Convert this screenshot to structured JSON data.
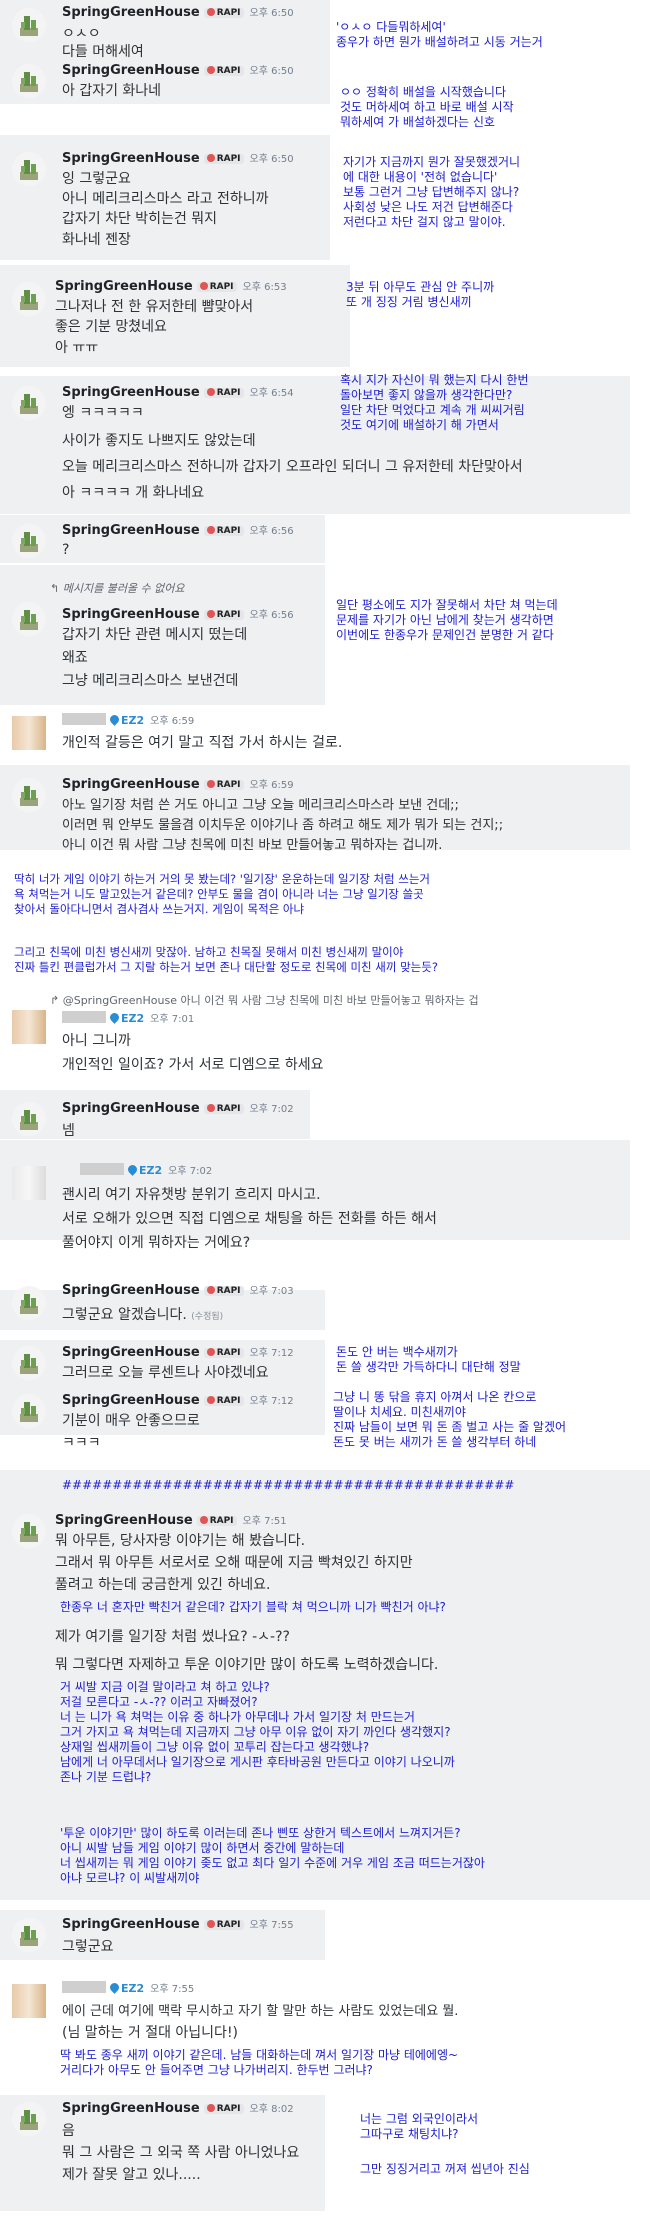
{
  "colors": {
    "annotation": "#2020d0",
    "highlight": "#eef0f2",
    "link": "#2a8cd4"
  },
  "user": {
    "name": "SpringGreenHouse",
    "badge": "RAPI"
  },
  "other": {
    "badge": "EZ2"
  },
  "msgs": [
    {
      "time": "오후 6:50",
      "lines": [
        "ㅇㅅㅇ",
        "다들 머해세여"
      ]
    },
    {
      "time": "오후 6:50",
      "lines": [
        "아 갑자기 화나네"
      ]
    },
    {
      "time": "오후 6:50",
      "lines": [
        "잉 그렇군요",
        "아니 메리크리스마스 라고 전하니까",
        "갑자기 차단 박히는건 뭐지",
        "화나네 젠장"
      ]
    },
    {
      "time": "오후 6:53",
      "lines": [
        "그나저나 전 한 유저한테 뺨맞아서",
        "좋은 기분 망쳤네요",
        "아 ㅠㅠ"
      ]
    },
    {
      "time": "오후 6:54",
      "lines": [
        "엥 ㅋㅋㅋㅋㅋ",
        "사이가 좋지도 나쁘지도 않았는데",
        "오늘 메리크리스마스 전하니까 갑자기 오프라인 되더니 그 유저한테 차단맞아서",
        "아 ㅋㅋㅋㅋ 개 화나네요"
      ]
    },
    {
      "time": "오후 6:56",
      "lines": [
        "?"
      ]
    },
    {
      "reply": "메시지를 불러올 수 없어요",
      "time": "오후 6:56",
      "lines": [
        "갑자기 차단 관련 메시지 떴는데",
        "왜죠",
        "그냥 메리크리스마스 보낸건데"
      ]
    },
    {
      "time": "오후 6:59",
      "lines": [
        "개인적 갈등은 여기 말고 직접 가서 하시는 걸로."
      ]
    },
    {
      "time": "오후 6:59",
      "lines": [
        "아노 일기장 처럼 쓴 거도 아니고 그냥 오늘 메리크리스마스라 보낸 건데;;",
        "이러면 뭐 안부도 물을겸 이치두운 이야기나 좀 하려고 해도 제가 뭐가 되는 건지;;",
        "아니 이건 뭐 사람 그냥 친목에 미친 바보 만들어놓고 뭐하자는 겁니까."
      ]
    },
    {
      "reply": "@SpringGreenHouse 아니 이건 뭐 사람 그냥 친목에 미친 바보 만들어놓고 뭐하자는 겁",
      "time": "오후 7:01",
      "lines": [
        "아니 그니까",
        "개인적인 일이죠? 가서 서로 디엠으로 하세요"
      ]
    },
    {
      "time": "오후 7:02",
      "lines": [
        "넴"
      ]
    },
    {
      "time": "오후 7:02",
      "lines": [
        "괜시리 여기 자유챗방 분위기 흐리지 마시고.",
        "서로 오해가 있으면 직접 디엠으로 채팅을 하든 전화를 하든 해서",
        "풀어야지 이게 뭐하자는 거에요?"
      ]
    },
    {
      "time": "오후 7:03",
      "lines": [
        "그렇군요 알겠습니다."
      ],
      "edited": "(수정됨)"
    },
    {
      "time": "오후 7:12",
      "lines": [
        "그러므로 오늘 루센트나 사야겠네요"
      ]
    },
    {
      "time": "오후 7:12",
      "lines": [
        "기분이 매우 안좋으므로",
        "ㅋㅋㅋ"
      ]
    },
    {
      "time": "오후 7:51",
      "lines": [
        "뭐 아무튼, 당사자랑 이야기는 해 봤습니다.",
        "그래서 뭐 아무튼 서로서로 오해 때문에 지금 빡쳐있긴 하지만",
        "풀려고 하는데 궁금한게 있긴 하네요.",
        "제가 여기를 일기장 처럼 썼나요? -ㅅ-??",
        "뭐 그렇다면 자제하고 투운 이야기만 많이 하도록 노력하겠습니다."
      ]
    },
    {
      "time": "오후 7:55",
      "lines": [
        "그렇군요"
      ]
    },
    {
      "time": "오후 7:55",
      "lines": [
        "에이 근데 여기에 맥락 무시하고 자기 할 말만 하는 사람도 있었는데요 뭘.",
        "(님 말하는 거 절대 아닙니다!)"
      ]
    },
    {
      "time": "오후 8:02",
      "lines": [
        "음",
        "뭐 그 사람은 그 외국 쪽 사람 아니었나요",
        "제가 잘못 알고 있나....."
      ]
    }
  ],
  "notes": [
    {
      "text": [
        "'ㅇㅅㅇ 다들뭐하세여'",
        "종우가 하면 뭔가 배설하려고 시동 거는거"
      ]
    },
    {
      "text": [
        "ㅇㅇ 정확히 배설을 시작했습니다",
        "것도 머하세여 하고 바로 배설 시작",
        "뭐하세여 가 배설하겠다는 신호"
      ]
    },
    {
      "text": [
        "자기가 지금까지 뭔가 잘못했겠거니",
        "에 대한 내용이 '전혀 없습니다'",
        "보통 그런거 그냥 답변해주지 않나?",
        "사회성 낮은 나도 저건 답변해준다",
        "저런다고 차단 걸지 않고 말이야."
      ]
    },
    {
      "text": [
        "3분 뒤 아무도 관심 안 주니까",
        "또 개 징징 거림 병신새끼"
      ]
    },
    {
      "text": [
        "혹시 지가 자신이 뭐 했는지 다시 한번",
        "돌아보면 좋지 않을까 생각한다만?",
        "일단 차단 먹었다고 계속 개 씨씨거림",
        "것도 여기에 배설하기 해 가면서"
      ]
    },
    {
      "text": [
        "일단 평소에도 지가 잘못해서 차단 쳐 먹는데",
        "문제를 자기가 아닌 남에게 찾는거 생각하면",
        "이번에도 한종우가 문제인건 분명한 거 같다"
      ]
    },
    {
      "text": [
        "딱히 너가 게임 이야기 하는거 거의 못 봤는데? '일기장' 운운하는데 일기장 처럼 쓰는거",
        "욕 쳐먹는거 니도 말고있는거 같은데? 안부도 물을 겸이 아니라 너는 그냥 일기장 쓸곳",
        "찾아서 돌아다니면서 겸사겸사 쓰는거지. 게임이 목적은 아냐"
      ]
    },
    {
      "text": [
        "그리고 친목에 미친 병신새끼 맞잖아. 남하고 친목질 못해서 미친 병신새끼 말이야",
        "진짜 틀킨 편클럽가서 그 지랄 하는거 보면 존나 대단할 정도로 친목에 미친 새끼 맞는듯?"
      ]
    },
    {
      "text": [
        "돈도 안 버는 백수새끼가",
        "돈 쓸 생각만 가득하다니 대단해 정말"
      ]
    },
    {
      "text": [
        "그냥 니 똥 닦을 휴지 아껴서 나온 칸으로",
        "딸이나 치세요. 미친새끼야",
        "진짜 남들이 보면 뭐 돈 좀 벌고 사는 줄 알겠어",
        "돈도 못 버는 새끼가 돈 쓸 생각부터 하네"
      ]
    },
    {
      "text": [
        "#############################################"
      ]
    },
    {
      "text": [
        "한종우 너 혼자만 빡친거 같은데? 갑자기 블락 쳐 먹으니까 니가 빡친거 아냐?"
      ]
    },
    {
      "text": [
        "거 씨발 지금 이걸 말이라고 쳐 하고 있냐?",
        "저걸 모른다고 -ㅅ-?? 이러고 자빠졌어?",
        "너 는 니가 욕 쳐먹는 이유 중 하나가 아무데나 가서 일기장 처 만드는거",
        "그거 가지고 욕 쳐먹는데 지금까지 그냥 아무 이유 없이 자기 까인다 생각했지?",
        "상재일 씹새끼들이 그냥 이유 없이 꼬투리 잡는다고 생각했냐?",
        "남에게 너 아무데서나 일기장으로 게시판 후타바공원 만든다고 이야기 나오니까",
        "존나 기분 드럽냐?"
      ]
    },
    {
      "text": [
        "'투운 이야기만' 많이 하도록 이러는데 존나 삔또 상한거 텍스트에서 느껴지거든?",
        "아니 씨발 남들 게임 이야기 많이 하면서 중간에 말하는데",
        "너 씹새끼는 뭐 게임 이야기 좆도 없고 최다 일기 수준에 거우 게임 조금 떠드는거잖아",
        "아냐 모르냐? 이 씨발새끼야"
      ]
    },
    {
      "text": [
        "딱 봐도 종우 새끼 이야기 같은데. 남들 대화하는데 껴서 일기장 마냥 테에에엥~",
        "거리다가 아무도 안 들어주면 그냥 나가버리지. 한두번 그러냐?"
      ]
    },
    {
      "text": [
        "너는 그럼 외국인이라서",
        "그따구로 채팅치냐?"
      ]
    },
    {
      "text": [
        "그만 징징거리고 꺼져 씹년아 진심"
      ]
    }
  ]
}
